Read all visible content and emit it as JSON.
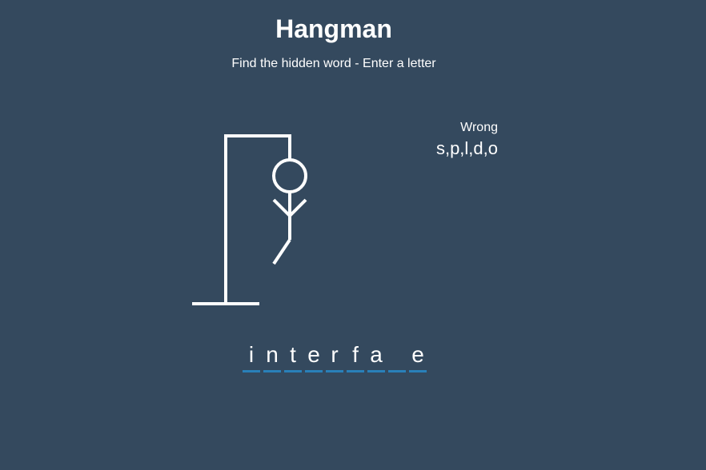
{
  "header": {
    "title": "Hangman",
    "subtitle": "Find the hidden word - Enter a letter"
  },
  "wrong": {
    "label": "Wrong",
    "letters": "s,p,l,d,o"
  },
  "word": {
    "letters": [
      "i",
      "n",
      "t",
      "e",
      "r",
      "f",
      "a",
      "",
      "e"
    ]
  },
  "colors": {
    "background": "#34495e",
    "text": "#ffffff",
    "underline": "#2980b9"
  },
  "hangman": {
    "parts_shown": [
      "gallows",
      "head",
      "body",
      "left-arm",
      "right-arm",
      "left-leg"
    ]
  }
}
